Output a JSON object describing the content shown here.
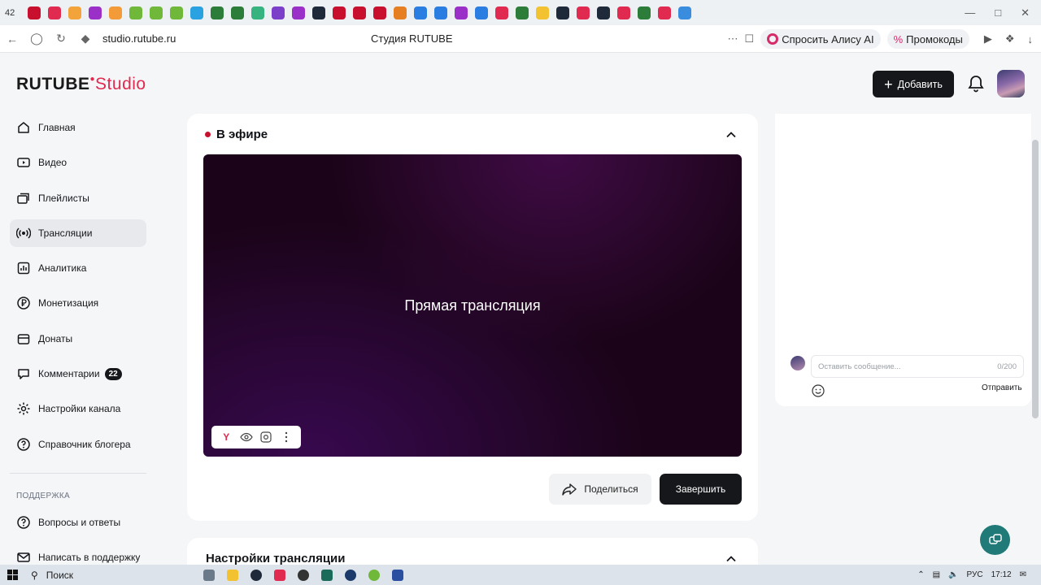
{
  "browser": {
    "tab_count": "42",
    "url": "studio.rutube.ru",
    "page_title": "Студия RUTUBE",
    "ask_alice": "Спросить Алису AI",
    "promo": "Промокоды"
  },
  "header": {
    "logo_main": "RUTUBE",
    "logo_studio": "Studio",
    "add_button": "Добавить"
  },
  "sidebar": {
    "items": [
      {
        "label": "Главная",
        "icon": "home-icon"
      },
      {
        "label": "Видео",
        "icon": "video-icon"
      },
      {
        "label": "Плейлисты",
        "icon": "playlist-icon"
      },
      {
        "label": "Трансляции",
        "icon": "broadcast-icon",
        "active": true
      },
      {
        "label": "Аналитика",
        "icon": "analytics-icon"
      },
      {
        "label": "Монетизация",
        "icon": "ruble-icon"
      },
      {
        "label": "Донаты",
        "icon": "donate-icon"
      },
      {
        "label": "Комментарии",
        "icon": "comments-icon",
        "badge": "22"
      },
      {
        "label": "Настройки канала",
        "icon": "gear-icon"
      },
      {
        "label": "Справочник блогера",
        "icon": "help-circle-icon"
      }
    ],
    "support_title": "ПОДДЕРЖКА",
    "support_items": [
      {
        "label": "Вопросы и ответы",
        "icon": "faq-icon"
      },
      {
        "label": "Написать в поддержку",
        "icon": "mail-icon"
      }
    ]
  },
  "live": {
    "title": "В эфире",
    "player_text": "Прямая трансляция",
    "share_button": "Поделиться",
    "end_button": "Завершить"
  },
  "settings": {
    "title": "Настройки трансляции"
  },
  "chat": {
    "placeholder": "Оставить сообщение...",
    "counter": "0/200",
    "send_button": "Отправить"
  },
  "taskbar": {
    "search_label": "Поиск",
    "language": "РУС",
    "time": "17:12"
  },
  "colors": {
    "accent": "#e02a4f",
    "dark": "#16171a",
    "live_dot": "#c8102e",
    "help_fab": "#1f7a78"
  }
}
